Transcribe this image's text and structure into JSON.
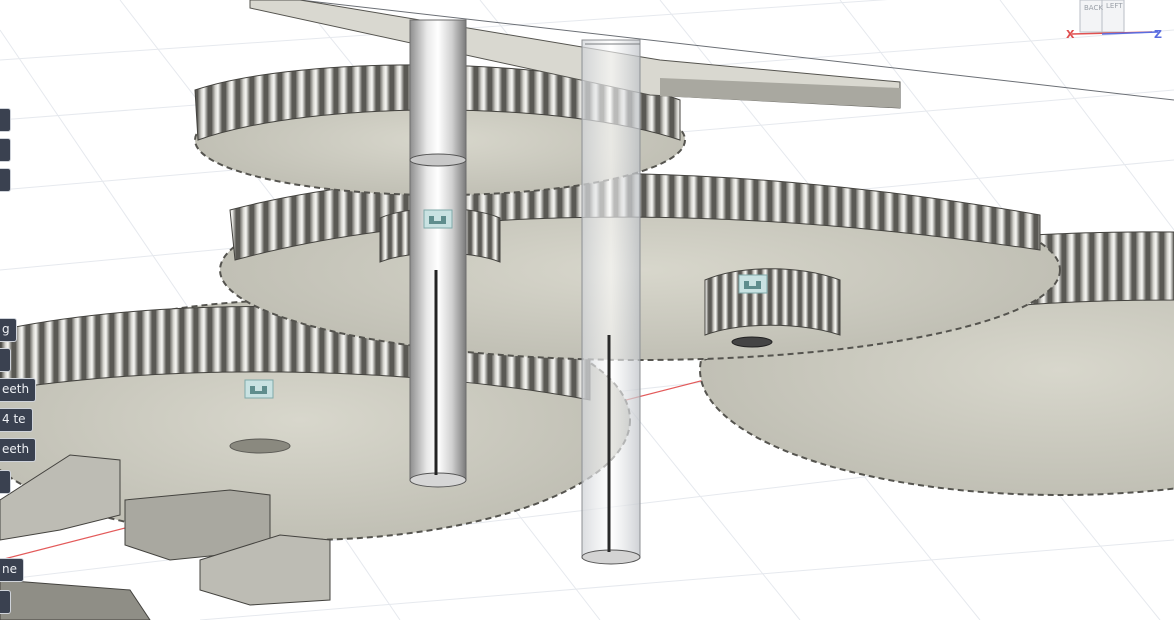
{
  "viewcube": {
    "faces": [
      "BACK",
      "LEFT"
    ],
    "axes": {
      "x": "X",
      "z": "Z"
    },
    "colors": {
      "x": "#e05050",
      "z": "#5a6de0"
    }
  },
  "browser_labels": [
    {
      "text": "g"
    },
    {
      "text": "eeth"
    },
    {
      "text": "4 te"
    },
    {
      "text": "eeth"
    },
    {
      "text": "ne"
    }
  ],
  "joint_icons": [
    "joint-icon",
    "joint-icon",
    "joint-icon",
    "joint-icon"
  ],
  "colors": {
    "background": "#ffffff",
    "grid": "#e6e9ee",
    "gear_face": "#c9c8bd",
    "gear_teeth": "#8e8d86",
    "axis_red": "#e35a5a",
    "shaft_glass": "#dde0e4",
    "tag_bg": "#3a4150"
  }
}
